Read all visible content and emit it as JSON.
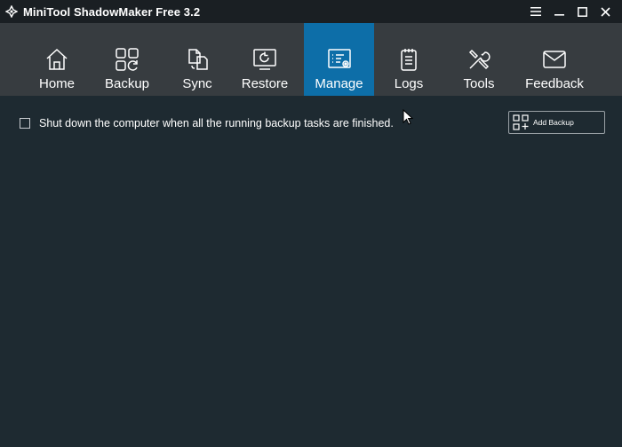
{
  "window": {
    "title": "MiniTool ShadowMaker Free 3.2",
    "controls": [
      "menu-icon",
      "minimize-icon",
      "maximize-icon",
      "close-icon"
    ]
  },
  "nav": {
    "items": [
      {
        "label": "Home",
        "icon": "home-icon"
      },
      {
        "label": "Backup",
        "icon": "backup-icon"
      },
      {
        "label": "Sync",
        "icon": "sync-icon"
      },
      {
        "label": "Restore",
        "icon": "restore-icon"
      },
      {
        "label": "Manage",
        "icon": "manage-icon",
        "active": true
      },
      {
        "label": "Logs",
        "icon": "logs-icon"
      },
      {
        "label": "Tools",
        "icon": "tools-icon"
      },
      {
        "label": "Feedback",
        "icon": "feedback-icon"
      }
    ]
  },
  "main": {
    "shutdown_label": "Shut down the computer when all the running backup tasks are finished.",
    "shutdown_checked": false,
    "add_backup_label": "Add Backup"
  },
  "colors": {
    "titlebar": "#1a1f23",
    "navbar": "#373c40",
    "active_tab": "#0d6ea8",
    "content_bg": "#1e2a31",
    "text": "#ffffff"
  }
}
